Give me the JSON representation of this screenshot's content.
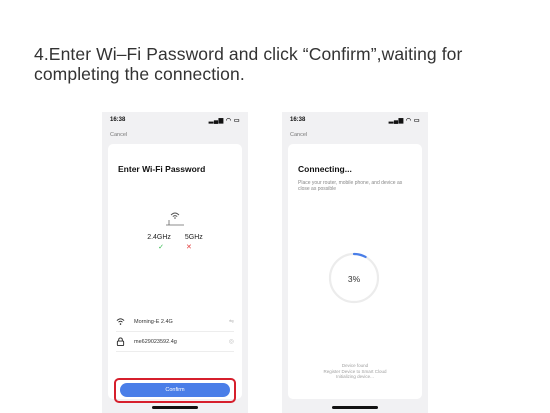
{
  "instruction": {
    "line1": "4.Enter Wi–Fi Password and click “Confirm”,waiting for",
    "line2": "completing the connection."
  },
  "left_phone": {
    "time": "16:38",
    "cancel": "Cancel",
    "title": "Enter Wi-Fi Password",
    "band_24": "2.4GHz",
    "band_5": "5GHz",
    "band_24_mark": "✓",
    "band_5_mark": "✕",
    "wifi_name": "Morning-E 2.4G",
    "password": "me629023592.4g",
    "confirm_label": "Confirm",
    "colors": {
      "ok": "#2eb84a",
      "no": "#e23a3a",
      "button": "#4a7ee8",
      "highlight": "#d61f2c"
    }
  },
  "right_phone": {
    "time": "16:38",
    "cancel": "Cancel",
    "title": "Connecting...",
    "description": "Place your router, mobile phone, and device as close as possible",
    "progress_percent": 3,
    "progress_label": "3%",
    "step1": "Device found",
    "step2": "Register Device to Smart Cloud",
    "step3": "Initializing device..."
  }
}
